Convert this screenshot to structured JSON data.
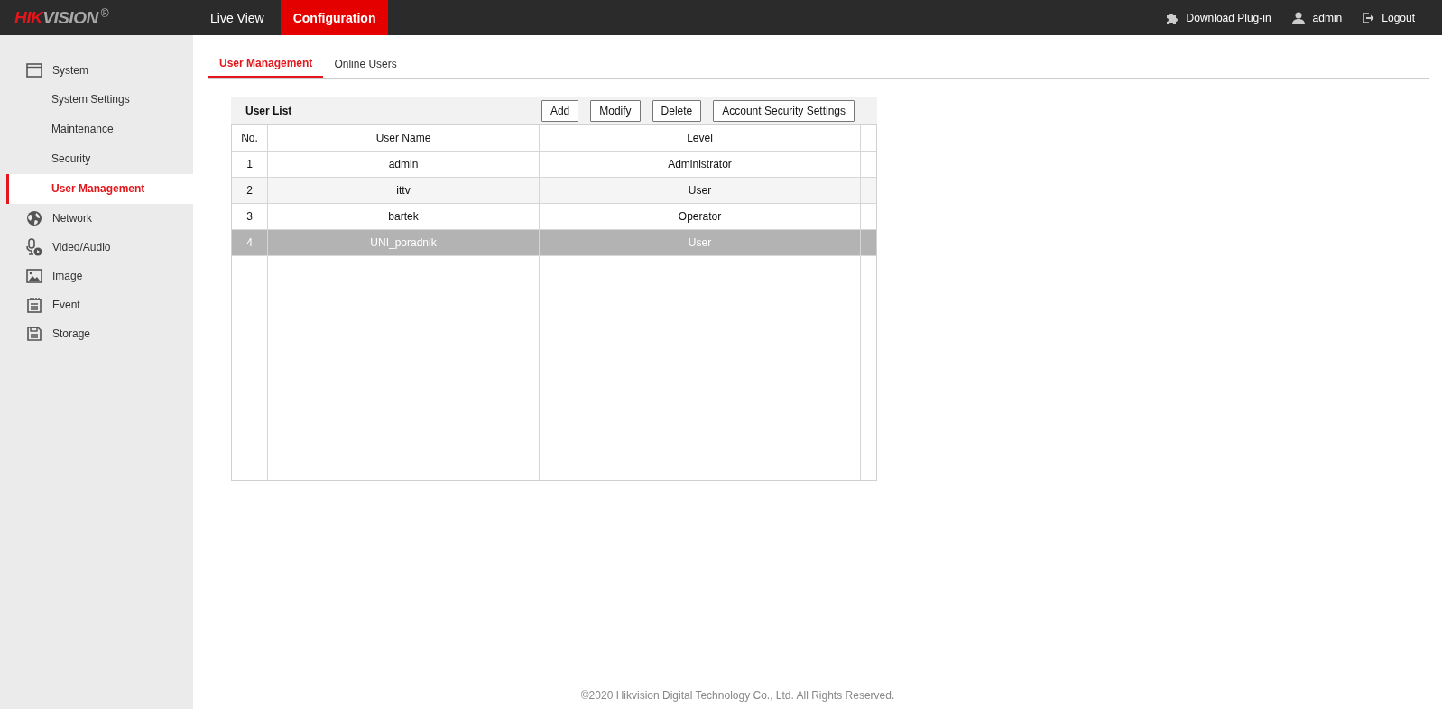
{
  "logo": {
    "accent": "HIK",
    "rest": "VISION",
    "registered": "®"
  },
  "nav_tabs": [
    {
      "label": "Live View",
      "selected": false
    },
    {
      "label": "Configuration",
      "selected": true
    }
  ],
  "top_actions": [
    {
      "kind": "plugin",
      "label": "Download Plug-in"
    },
    {
      "kind": "user",
      "label": "admin"
    },
    {
      "kind": "logout",
      "label": "Logout"
    }
  ],
  "sidebar": {
    "items": [
      {
        "kind": "system",
        "label": "System",
        "children": [
          {
            "label": "System Settings",
            "selected": false
          },
          {
            "label": "Maintenance",
            "selected": false
          },
          {
            "label": "Security",
            "selected": false
          },
          {
            "label": "User Management",
            "selected": true
          }
        ]
      },
      {
        "kind": "network",
        "label": "Network"
      },
      {
        "kind": "video",
        "label": "Video/Audio"
      },
      {
        "kind": "image",
        "label": "Image"
      },
      {
        "kind": "event",
        "label": "Event"
      },
      {
        "kind": "storage",
        "label": "Storage"
      }
    ]
  },
  "tabs": [
    {
      "label": "User Management",
      "selected": true
    },
    {
      "label": "Online Users",
      "selected": false
    }
  ],
  "user_list": {
    "title": "User List",
    "buttons": [
      "Add",
      "Modify",
      "Delete",
      "Account Security Settings"
    ],
    "columns": [
      "No.",
      "User Name",
      "Level"
    ],
    "rows": [
      {
        "no": "1",
        "user_name": "admin",
        "level_name": "Administrator",
        "selected": false
      },
      {
        "no": "2",
        "user_name": "ittv",
        "level_name": "User",
        "selected": false
      },
      {
        "no": "3",
        "user_name": "bartek",
        "level_name": "Operator",
        "selected": false
      },
      {
        "no": "4",
        "user_name": "UNI_poradnik",
        "level_name": "User",
        "selected": true
      }
    ]
  },
  "footer": "©2020 Hikvision Digital Technology Co., Ltd. All Rights Reserved."
}
